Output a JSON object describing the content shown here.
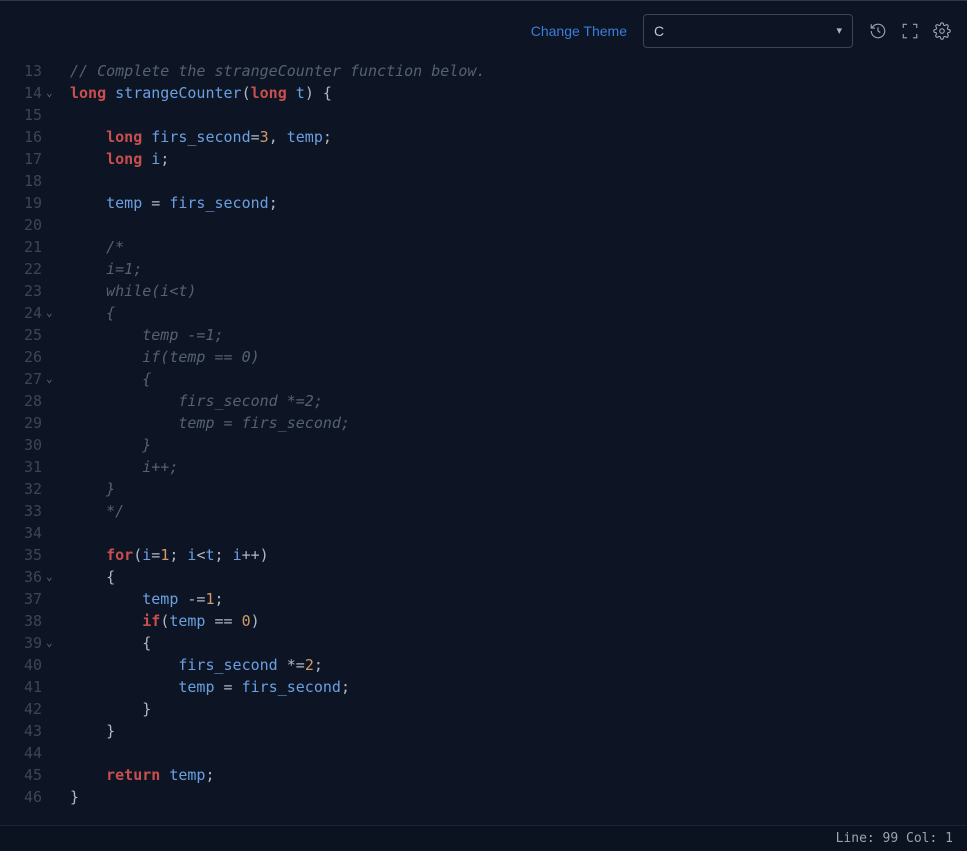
{
  "toolbar": {
    "change_theme": "Change Theme",
    "language": "C"
  },
  "status": {
    "line_col": "Line: 99 Col: 1"
  },
  "gutter": {
    "start": 13,
    "folds": [
      14,
      24,
      27,
      36,
      39
    ]
  },
  "code": {
    "lines": [
      {
        "cls": "cm",
        "t": "// Complete the strangeCounter function below."
      },
      {
        "html": "<span class='kw'>long</span> <span class='fn'>strangeCounter</span><span class='punct'>(</span><span class='kw'>long</span> <span class='var'>t</span><span class='punct'>) {</span>"
      },
      {
        "t": ""
      },
      {
        "html": "    <span class='kw'>long</span> <span class='var'>firs_second</span><span class='op'>=</span><span class='num'>3</span><span class='punct'>,</span> <span class='var'>temp</span><span class='punct'>;</span>"
      },
      {
        "html": "    <span class='kw'>long</span> <span class='var'>i</span><span class='punct'>;</span>"
      },
      {
        "t": ""
      },
      {
        "html": "    <span class='var'>temp</span> <span class='op'>=</span> <span class='var'>firs_second</span><span class='punct'>;</span>"
      },
      {
        "t": ""
      },
      {
        "cls": "cm",
        "t": "    /*"
      },
      {
        "cls": "cm",
        "t": "    i=1;"
      },
      {
        "cls": "cm",
        "t": "    while(i<t)"
      },
      {
        "cls": "cm",
        "t": "    {"
      },
      {
        "cls": "cm",
        "t": "        temp -=1;"
      },
      {
        "cls": "cm",
        "t": "        if(temp == 0)"
      },
      {
        "cls": "cm",
        "t": "        {"
      },
      {
        "cls": "cm",
        "t": "            firs_second *=2;"
      },
      {
        "cls": "cm",
        "t": "            temp = firs_second;"
      },
      {
        "cls": "cm",
        "t": "        }"
      },
      {
        "cls": "cm",
        "t": "        i++;"
      },
      {
        "cls": "cm",
        "t": "    }"
      },
      {
        "cls": "cm",
        "t": "    */"
      },
      {
        "t": ""
      },
      {
        "html": "    <span class='kw2'>for</span><span class='punct'>(</span><span class='var'>i</span><span class='op'>=</span><span class='num'>1</span><span class='punct'>;</span> <span class='var'>i</span><span class='op'>&lt;</span><span class='var'>t</span><span class='punct'>;</span> <span class='var'>i</span><span class='op'>++</span><span class='punct'>)</span>"
      },
      {
        "html": "    <span class='punct'>{</span>"
      },
      {
        "html": "        <span class='var'>temp</span> <span class='op'>-=</span><span class='num'>1</span><span class='punct'>;</span>"
      },
      {
        "html": "        <span class='kw2'>if</span><span class='punct'>(</span><span class='var'>temp</span> <span class='op'>==</span> <span class='num'>0</span><span class='punct'>)</span>"
      },
      {
        "html": "        <span class='punct'>{</span>"
      },
      {
        "html": "            <span class='var'>firs_second</span> <span class='op'>*=</span><span class='num'>2</span><span class='punct'>;</span>"
      },
      {
        "html": "            <span class='var'>temp</span> <span class='op'>=</span> <span class='var'>firs_second</span><span class='punct'>;</span>"
      },
      {
        "html": "        <span class='punct'>}</span>"
      },
      {
        "html": "    <span class='punct'>}</span>"
      },
      {
        "t": ""
      },
      {
        "html": "    <span class='kw2'>return</span> <span class='var'>temp</span><span class='punct'>;</span>"
      },
      {
        "html": "<span class='punct'>}</span>"
      }
    ]
  }
}
